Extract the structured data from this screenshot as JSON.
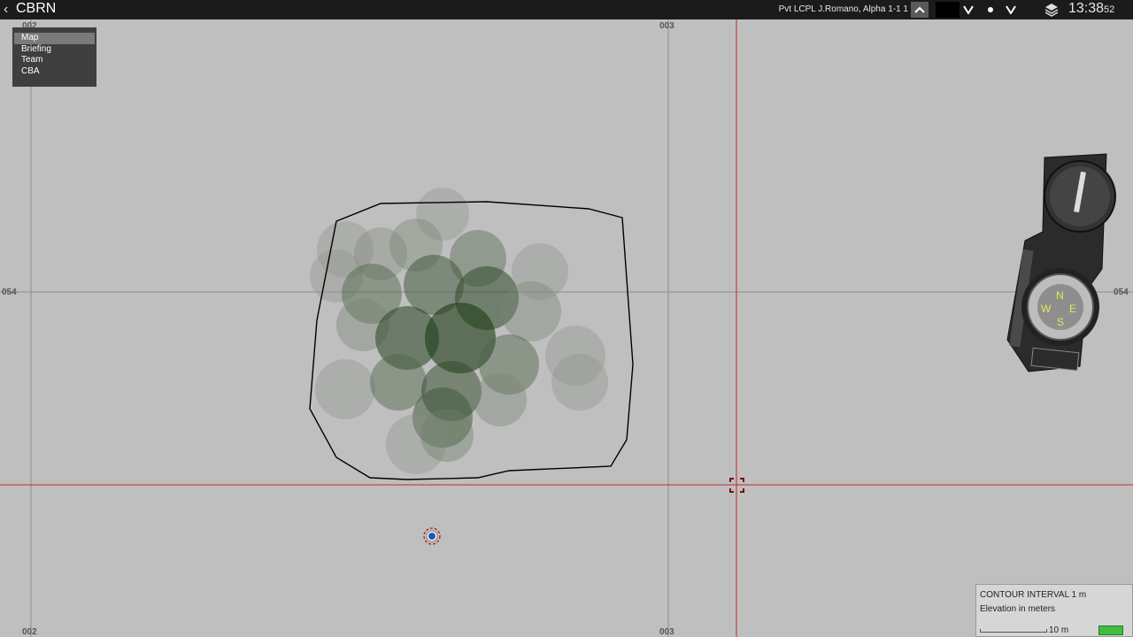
{
  "topbar": {
    "title": "CBRN",
    "player": "Pvt LCPL J.Romano, Alpha 1-1 1",
    "time_hm": "13:38",
    "time_sec": "52"
  },
  "menu": {
    "items": [
      {
        "label": "Map",
        "active": true
      },
      {
        "label": "Briefing",
        "active": false
      },
      {
        "label": "Team",
        "active": false
      },
      {
        "label": "CBA",
        "active": false
      }
    ]
  },
  "map": {
    "grid_labels": {
      "top_left": "002",
      "top_mid": "003",
      "left": "054",
      "right": "054",
      "bottom_left": "002",
      "bottom_mid": "003"
    },
    "colors": {
      "background": "#bfbfbf",
      "gridline": "#8c8c8c",
      "cursor_line": "#c0282d",
      "contamination": "#1c3a16",
      "smoke": "#8a8f88",
      "player_marker": "#1f56b8"
    }
  },
  "legend": {
    "title": "CONTOUR INTERVAL 1 m",
    "subtitle": "Elevation in meters",
    "scale_label": "10 m"
  },
  "icons": [
    "back-icon",
    "chevron-up-icon",
    "chevron-down-icon",
    "layers-icon",
    "compass-icon",
    "cursor-target-icon",
    "player-marker-icon"
  ]
}
